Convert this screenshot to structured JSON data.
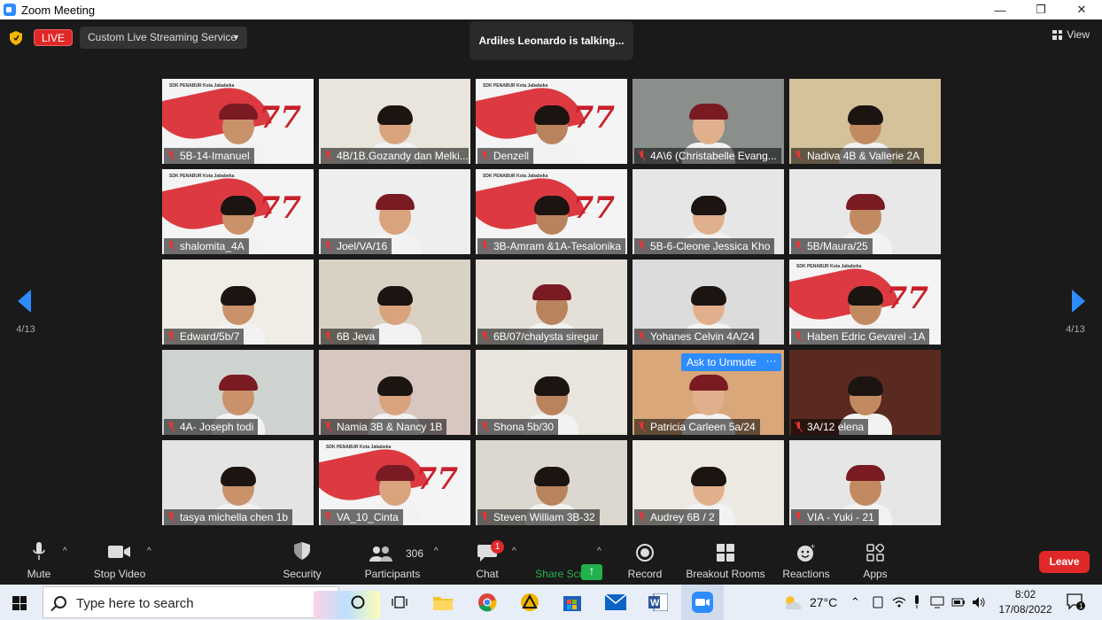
{
  "window": {
    "title": "Zoom Meeting",
    "minimize": "—",
    "restore": "❐",
    "close": "✕"
  },
  "header": {
    "live_label": "LIVE",
    "stream_service": "Custom Live Streaming Service",
    "talking_notice": "Ardiles Leonardo is talking...",
    "view_label": "View"
  },
  "pagination": {
    "left": "4/13",
    "right": "4/13"
  },
  "tiles": [
    {
      "name": "5B-14-Imanuel",
      "style": "banner",
      "bg": "#f4f4f4"
    },
    {
      "name": "4B/1B.Gozandy dan Melki...",
      "style": "plain",
      "bg": "#e9e4dc"
    },
    {
      "name": "Denzell",
      "style": "banner",
      "bg": "#f4f4f4"
    },
    {
      "name": "4A\\6 (Christabelle Evang...",
      "style": "plain",
      "bg": "#8a8f8c"
    },
    {
      "name": "Nadiva 4B & Vallerie 2A",
      "style": "plain",
      "bg": "#d4c29a"
    },
    {
      "name": "shalomita_4A",
      "style": "banner",
      "bg": "#f4f4f4"
    },
    {
      "name": "Joel/VA/16",
      "style": "plain",
      "bg": "#eeeeee"
    },
    {
      "name": "3B-Amram &1A-Tesalonika",
      "style": "banner",
      "bg": "#f4f4f4"
    },
    {
      "name": "5B-6-Cleone Jessica Kho",
      "style": "plain",
      "bg": "#e6e6e6"
    },
    {
      "name": "5B/Maura/25",
      "style": "plain",
      "bg": "#e8e8e8"
    },
    {
      "name": "Edward/5b/7",
      "style": "plain",
      "bg": "#f0ede6"
    },
    {
      "name": "6B Jeva",
      "style": "plain",
      "bg": "#d9d2c4"
    },
    {
      "name": "6B/07/chalysta siregar",
      "style": "plain",
      "bg": "#e4e0d8"
    },
    {
      "name": "Yohanes Celvin 4A/24",
      "style": "plain",
      "bg": "#dcdcdc"
    },
    {
      "name": "Haben Edric Gevarel -1A",
      "style": "banner",
      "bg": "#f4f4f4"
    },
    {
      "name": "4A- Joseph todi",
      "style": "plain",
      "bg": "#cfd3cf"
    },
    {
      "name": "Namia 3B & Nancy 1B",
      "style": "plain",
      "bg": "#d8c6c0"
    },
    {
      "name": "Shona 5b/30",
      "style": "plain",
      "bg": "#e8e5df"
    },
    {
      "name": "Patricia Carleen 5a/24",
      "style": "plain",
      "bg": "#d9a77a"
    },
    {
      "name": "3A/12 elena",
      "style": "plain",
      "bg": "#5a2a20"
    },
    {
      "name": "tasya michella chen 1b",
      "style": "plain",
      "bg": "#e4e4e4"
    },
    {
      "name": "VA_10_Cinta",
      "style": "banner",
      "bg": "#f4f4f4"
    },
    {
      "name": "Steven William 3B-32",
      "style": "plain",
      "bg": "#dcd8cf"
    },
    {
      "name": "Audrey 6B / 2",
      "style": "plain",
      "bg": "#ece9e2"
    },
    {
      "name": "VIA - Yuki - 21",
      "style": "plain",
      "bg": "#e6e6e6"
    }
  ],
  "tile_banner": {
    "header_text": "SDK PENABUR Kota Jababeka",
    "number": "77"
  },
  "tile_actions": {
    "unmute_label": "Ask to Unmute",
    "more_label": "···"
  },
  "toolbar": {
    "mute": "Mute",
    "stop_video": "Stop Video",
    "security": "Security",
    "participants": "Participants",
    "participants_count": "306",
    "chat": "Chat",
    "chat_badge": "1",
    "share_screen": "Share Screen",
    "record": "Record",
    "breakout_rooms": "Breakout Rooms",
    "reactions": "Reactions",
    "apps": "Apps",
    "leave": "Leave"
  },
  "taskbar": {
    "search_placeholder": "Type here to search",
    "weather": "27°C",
    "time": "8:02",
    "date": "17/08/2022",
    "notification_count": "1"
  },
  "colors": {
    "accent": "#2d8cff",
    "live": "#e02828",
    "share": "#23b14d",
    "muted": "#e33333"
  }
}
